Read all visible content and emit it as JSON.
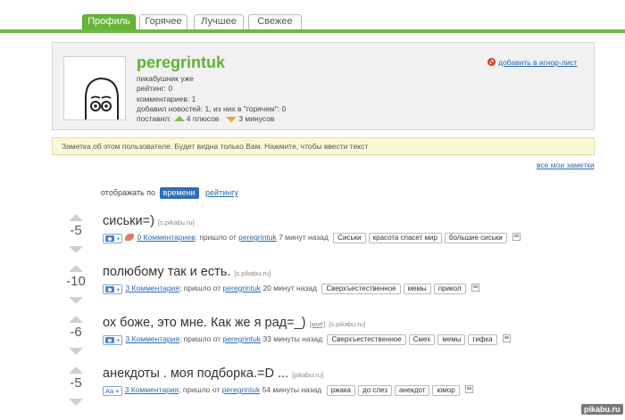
{
  "tabs": [
    "Профиль",
    "Горячее",
    "Лучшее",
    "Свежее"
  ],
  "profile": {
    "username": "peregrintuk",
    "lines": [
      "пикабушник уже",
      "рейтинг: 0",
      "комментариев: 1",
      "добавил новостей: 1, из них в \"горячем\": 0"
    ],
    "gave_label": "поставил:",
    "pluses": "4 плюсов",
    "minuses": "3 минусов",
    "ignore_label": "добавить в игнор-лист"
  },
  "note": {
    "text": "Заметка об этом пользователе. Будет видна только Вам. Нажмите, чтобы ввести текст",
    "all_notes": "все мои заметки"
  },
  "sort": {
    "label": "отображать по",
    "active": "времени",
    "other": "рейтингу"
  },
  "posts": [
    {
      "score": "-5",
      "title": "сиськи=)",
      "domain": "[s.pikabu.ru]",
      "type": "image",
      "comments": "0 Комментариев",
      "sep": "; пришло от",
      "author": "peregrintuk",
      "time": "7 минут назад",
      "tags": [
        "Сиськи",
        "красота спасет мир",
        "большие сиськи"
      ]
    },
    {
      "score": "-10",
      "title": "полюбому так и есть.",
      "domain": "[s.pikabu.ru]",
      "type": "image",
      "comments": "3 Комментария",
      "sep": "; пришло от",
      "author": "peregrintuk",
      "time": "20 минут назад",
      "tags": [
        "Сверхъестественное",
        "мемы",
        "прикол"
      ]
    },
    {
      "score": "-6",
      "title": "ох боже, это мне. Как же я рад=_)",
      "domain": "[моё]",
      "domain2": "[s.pikabu.ru]",
      "type": "image",
      "comments": "3 Комментария",
      "sep": "; пришло от",
      "author": "peregrintuk",
      "time": "33 минуты назад",
      "tags": [
        "Сверхъестественное",
        "Смех",
        "мемы",
        "гифка"
      ]
    },
    {
      "score": "-5",
      "title": "анекдоты . моя подборка.=D ...",
      "domain": "[pikabu.ru]",
      "type": "text",
      "type_label": "Aa +",
      "comments": "3 Комментария",
      "sep": "; пришло от",
      "author": "peregrintuk",
      "time": "54 минуты назад",
      "tags": [
        "ржака",
        "до слез",
        "анекдот",
        "юмор"
      ]
    }
  ],
  "watermark": "pikabu.ru",
  "colors": {
    "accent": "#6cbb3c",
    "link": "#2b6bb2",
    "username": "#5cb531"
  }
}
